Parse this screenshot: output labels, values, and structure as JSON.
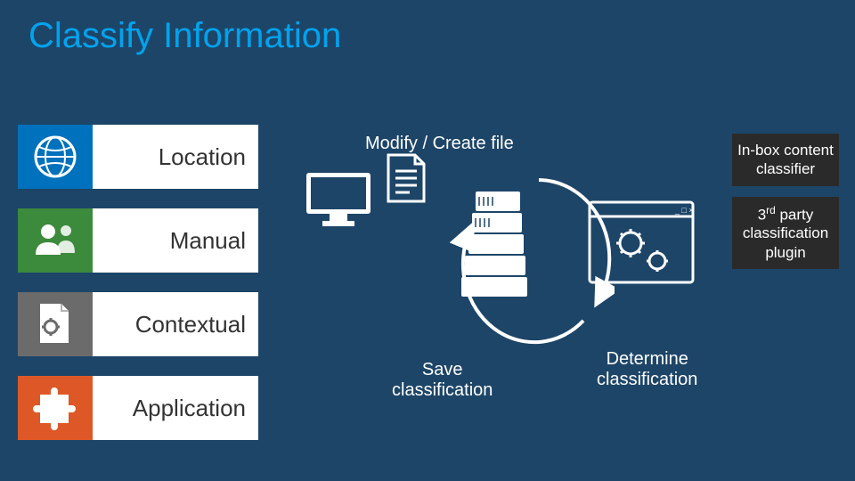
{
  "title": "Classify Information",
  "tiles": [
    {
      "label": "Location",
      "icon": "globe-icon"
    },
    {
      "label": "Manual",
      "icon": "people-icon"
    },
    {
      "label": "Contextual",
      "icon": "doc-gear-icon"
    },
    {
      "label": "Application",
      "icon": "puzzle-icon"
    }
  ],
  "flow": {
    "top": "Modify / Create file",
    "save": "Save\nclassification",
    "determine": "Determine\nclassification"
  },
  "right": [
    "In-box content classifier",
    "3rd party classification plugin"
  ],
  "chart_data": {
    "type": "diagram",
    "title": "Classify Information",
    "categories_left": [
      "Location",
      "Manual",
      "Contextual",
      "Application"
    ],
    "cycle_steps": [
      "Modify / Create file",
      "Determine classification",
      "Save classification"
    ],
    "classifiers": [
      "In-box content classifier",
      "3rd party classification plugin"
    ],
    "nodes": [
      "client-monitor",
      "document",
      "file-server",
      "app-window-gears"
    ]
  }
}
